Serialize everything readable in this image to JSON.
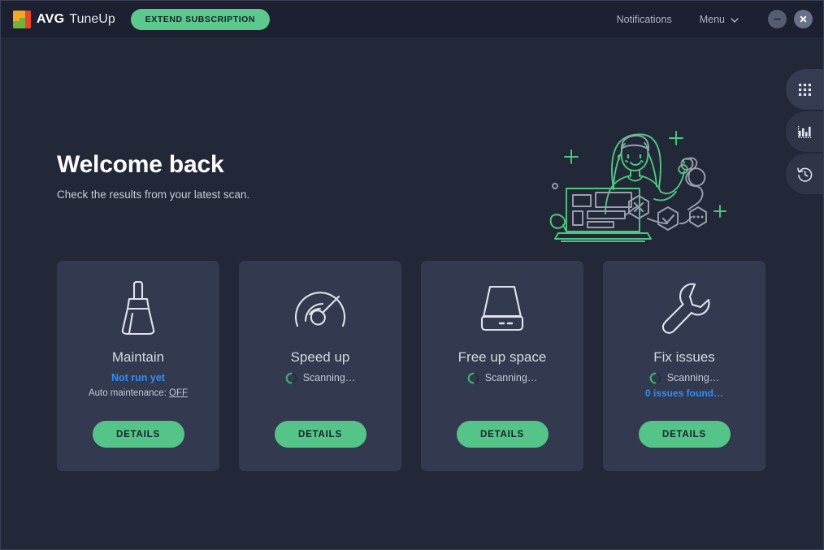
{
  "window": {
    "brand_primary": "AVG",
    "brand_secondary": "TuneUp",
    "extend_label": "EXTEND SUBSCRIPTION",
    "notifications_label": "Notifications",
    "menu_label": "Menu",
    "minimize_icon": "minimize-icon",
    "close_icon": "close-icon",
    "accent_green": "#5bc98c",
    "accent_blue": "#2e8ef7",
    "bg": "#232838",
    "titlebar_bg": "#1c2030",
    "card_bg": "#333a50"
  },
  "rail": {
    "tabs": [
      {
        "icon": "grid-icon",
        "name": "all-tools-tab"
      },
      {
        "icon": "bar-chart-icon",
        "name": "reports-tab"
      },
      {
        "icon": "history-icon",
        "name": "history-tab"
      }
    ]
  },
  "hero": {
    "title": "Welcome back",
    "subtitle": "Check the results from your latest scan."
  },
  "cards": [
    {
      "id": "maintain",
      "icon": "broom-icon",
      "title": "Maintain",
      "status_text": "Not run yet",
      "status_type": "blue",
      "has_spinner": false,
      "sub_prefix": "Auto maintenance: ",
      "sub_value": "OFF",
      "sub2": "",
      "button": "DETAILS"
    },
    {
      "id": "speed-up",
      "icon": "speedometer-icon",
      "title": "Speed up",
      "status_text": "Scanning…",
      "status_type": "scan",
      "has_spinner": true,
      "sub_prefix": "",
      "sub_value": "",
      "sub2": "",
      "button": "DETAILS"
    },
    {
      "id": "free-up-space",
      "icon": "hard-drive-icon",
      "title": "Free up space",
      "status_text": "Scanning…",
      "status_type": "scan",
      "has_spinner": true,
      "sub_prefix": "",
      "sub_value": "",
      "sub2": "",
      "button": "DETAILS"
    },
    {
      "id": "fix-issues",
      "icon": "wrench-icon",
      "title": "Fix issues",
      "status_text": "Scanning…",
      "status_type": "scan",
      "has_spinner": true,
      "sub_prefix": "",
      "sub_value": "",
      "sub2": "0 issues found…",
      "button": "DETAILS"
    }
  ],
  "illustration": {
    "name": "woman-at-laptop-illustration",
    "green": "#4ec87f",
    "gray": "#9aa0b0"
  }
}
